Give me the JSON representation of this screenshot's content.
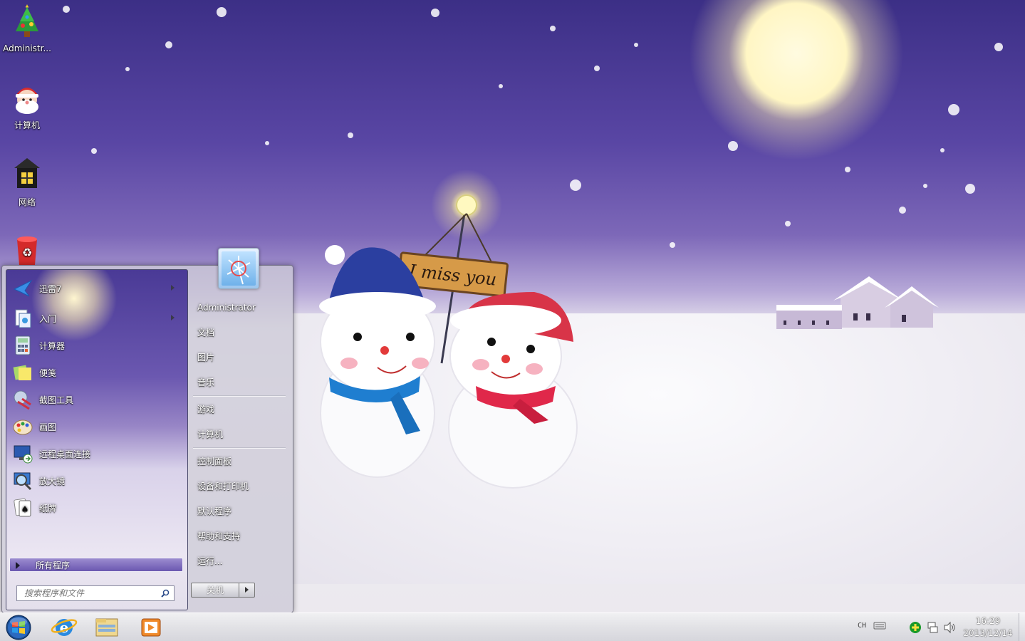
{
  "desktop": {
    "icons": [
      {
        "label": "Administr...",
        "icon": "christmas-tree-icon"
      },
      {
        "label": "计算机",
        "icon": "santa-computer-icon"
      },
      {
        "label": "网络",
        "icon": "lantern-network-icon"
      },
      {
        "label": "",
        "icon": "recycle-bin-icon"
      }
    ],
    "wallpaper_sign": "I miss you"
  },
  "start_menu": {
    "programs": [
      {
        "label": "迅雷7",
        "icon": "xunlei-bird-icon",
        "has_submenu": true
      },
      {
        "label": "入门",
        "icon": "getting-started-icon",
        "has_submenu": true
      },
      {
        "label": "计算器",
        "icon": "calculator-icon",
        "has_submenu": false
      },
      {
        "label": "便笺",
        "icon": "sticky-notes-icon",
        "has_submenu": false
      },
      {
        "label": "截图工具",
        "icon": "snipping-tool-icon",
        "has_submenu": false
      },
      {
        "label": "画图",
        "icon": "paint-palette-icon",
        "has_submenu": false
      },
      {
        "label": "远程桌面连接",
        "icon": "remote-desktop-icon",
        "has_submenu": false
      },
      {
        "label": "放大镜",
        "icon": "magnifier-icon",
        "has_submenu": false
      },
      {
        "label": "纸牌",
        "icon": "solitaire-cards-icon",
        "has_submenu": false
      }
    ],
    "all_programs": "所有程序",
    "search_placeholder": "搜索程序和文件",
    "user_name": "Administrator",
    "right_items": [
      "文档",
      "图片",
      "音乐",
      "游戏",
      "计算机",
      "控制面板",
      "设备和打印机",
      "默认程序",
      "帮助和支持",
      "运行..."
    ],
    "shutdown": "关机"
  },
  "taskbar": {
    "pinned": [
      "start-orb-icon",
      "internet-explorer-icon",
      "windows-explorer-icon",
      "media-player-icon"
    ],
    "tray": {
      "language": "CH",
      "time": "16:29",
      "date": "2013/12/14"
    }
  },
  "colors": {
    "sky_top": "#3c2f86",
    "sky_bottom": "#b7a9d8",
    "snow": "#f1eff3",
    "menu_accent": "#6a57b0"
  }
}
